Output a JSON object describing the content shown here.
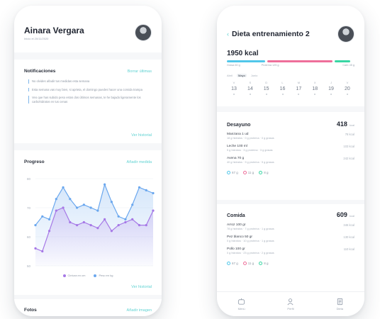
{
  "left": {
    "user_name": "Ainara Vergara",
    "user_sub": "Inicio el 20/11/2020",
    "notifications": {
      "title": "Notificaciones",
      "action": "Borrar últimas",
      "items": [
        "No olvides añadir tus medidas esta semana",
        "Esta semana vas muy bien, si aprieta, el domingo puedes hacer una comida trampa",
        "Veo que has subido peso estos dos últimos semanas, te he bajado ligeramente los carbohidratos en tus cenas"
      ],
      "history": "Ver historial"
    },
    "progress": {
      "title": "Progreso",
      "action": "Añadir medida",
      "y_ticks": [
        "80",
        "70",
        "60",
        "50"
      ],
      "legend": [
        "Cintura en cm",
        "Peso en kg"
      ],
      "history": "Ver historial"
    },
    "photos": {
      "title": "Fotos",
      "action": "Añadir imagen"
    },
    "chart_data": {
      "type": "line",
      "ylim": [
        50,
        80
      ],
      "series": [
        {
          "name": "Peso en kg",
          "color": "#6aa7ee",
          "values": [
            64,
            67,
            66,
            73,
            77,
            73,
            70,
            71,
            70,
            69,
            78,
            72,
            67,
            66,
            71,
            77,
            76,
            75
          ]
        },
        {
          "name": "Cintura en cm",
          "color": "#a678e6",
          "values": [
            56,
            55,
            62,
            69,
            70,
            65,
            64,
            65,
            64,
            63,
            66,
            62,
            64,
            65,
            66,
            64,
            64,
            69
          ]
        }
      ]
    }
  },
  "right": {
    "title": "Dieta entrenamiento 2",
    "kcal": "1950 kcal",
    "macros": [
      {
        "label": "Grasa 60 g",
        "color": "#52c7ea"
      },
      {
        "label": "Proteína 125 g",
        "color": "#ee6f9a"
      },
      {
        "label": "Carb 45 g",
        "color": "#39d6a4"
      }
    ],
    "months": [
      "Abril",
      "Mayo",
      "Junio"
    ],
    "days": [
      {
        "n": "V",
        "d": "13"
      },
      {
        "n": "S",
        "d": "14"
      },
      {
        "n": "D",
        "d": "15"
      },
      {
        "n": "L",
        "d": "16"
      },
      {
        "n": "M",
        "d": "17"
      },
      {
        "n": "X",
        "d": "18"
      },
      {
        "n": "J",
        "d": "19"
      },
      {
        "n": "V",
        "d": "20"
      }
    ],
    "meals": [
      {
        "name": "Desayuno",
        "kcal": "418",
        "unit": "kcal",
        "foods": [
          {
            "name": "Manzana 1 ud",
            "detail": "18 g hidratos · 0 g proteína · 0 g grasas",
            "kcal": "78 kcal"
          },
          {
            "name": "Leche 100 ml",
            "detail": "5 g hidratos · 3 g proteína · 3 g grasas",
            "kcal": "103 kcal"
          },
          {
            "name": "Avena 70 g",
            "detail": "40 g hidratos · 9 g proteína · 5 g grasas",
            "kcal": "242 kcal"
          }
        ],
        "macros": [
          "67 g",
          "11 g",
          "8 g"
        ]
      },
      {
        "name": "Comida",
        "kcal": "609",
        "unit": "kcal",
        "foods": [
          {
            "name": "Arroz 100 gr",
            "detail": "78 g hidratos · 7 g proteína · 1 g grasas",
            "kcal": "346 kcal"
          },
          {
            "name": "Pez blanco 50 gr",
            "detail": "0 g hidratos · 10 g proteína · 1 g grasas",
            "kcal": "130 kcal"
          },
          {
            "name": "Pollo 100 gr",
            "detail": "0 g hidratos · 23 g proteína · 2 g grasas",
            "kcal": "110 kcal"
          }
        ],
        "macros": [
          "67 g",
          "11 g",
          "8 g"
        ]
      }
    ],
    "tabs": [
      "Menú",
      "Perfil",
      "Dieta"
    ]
  }
}
